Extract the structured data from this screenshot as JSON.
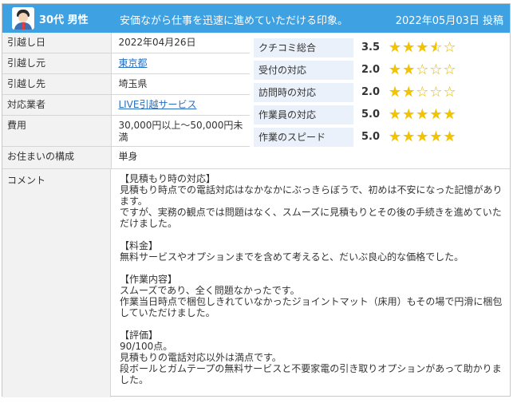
{
  "header": {
    "user": "30代 男性",
    "title": "安価ながら仕事を迅速に進めていただける印象。",
    "posted": "2022年05月03日 投稿",
    "colors": {
      "bar": "#3ea1e2",
      "text": "#ffffff"
    },
    "avatar_icon": "user-avatar-icon"
  },
  "info": [
    {
      "label": "引越し日",
      "value": "2022年04月26日",
      "link": false
    },
    {
      "label": "引越し元",
      "value": "東京都",
      "link": true
    },
    {
      "label": "引越し先",
      "value": "埼玉県",
      "link": false
    },
    {
      "label": "対応業者",
      "value": "LIVE引越サービス",
      "link": true
    },
    {
      "label": "費用",
      "value": "30,000円以上〜50,000円未満",
      "link": false
    },
    {
      "label": "お住まいの構成",
      "value": "単身",
      "link": false
    }
  ],
  "ratings": [
    {
      "label": "クチコミ総合",
      "score": "3.5",
      "stars": 3.5
    },
    {
      "label": "受付の対応",
      "score": "2.0",
      "stars": 2.0
    },
    {
      "label": "訪問時の対応",
      "score": "2.0",
      "stars": 2.0
    },
    {
      "label": "作業員の対応",
      "score": "5.0",
      "stars": 5.0
    },
    {
      "label": "作業のスピード",
      "score": "5.0",
      "stars": 5.0
    }
  ],
  "star_color": "#f3c300",
  "comment": {
    "label": "コメント",
    "text": "【見積もり時の対応】\n見積もり時点での電話対応はなかなかにぶっきらぼうで、初めは不安になった記憶があります。\nですが、実務の観点では問題はなく、スムーズに見積もりとその後の手続きを進めていただけました。\n\n【料金】\n無料サービスやオプションまでを含めて考えると、だいぶ良心的な価格でした。\n\n【作業内容】\nスムーズであり、全く問題なかったです。\n作業当日時点で梱包しきれていなかったジョイントマット（床用）もその場で円滑に梱包していただけました。\n\n【評価】\n90/100点。\n見積もりの電話対応以外は満点です。\n段ボールとガムテープの無料サービスと不要家電の引き取りオプションがあって助かりました。"
  }
}
